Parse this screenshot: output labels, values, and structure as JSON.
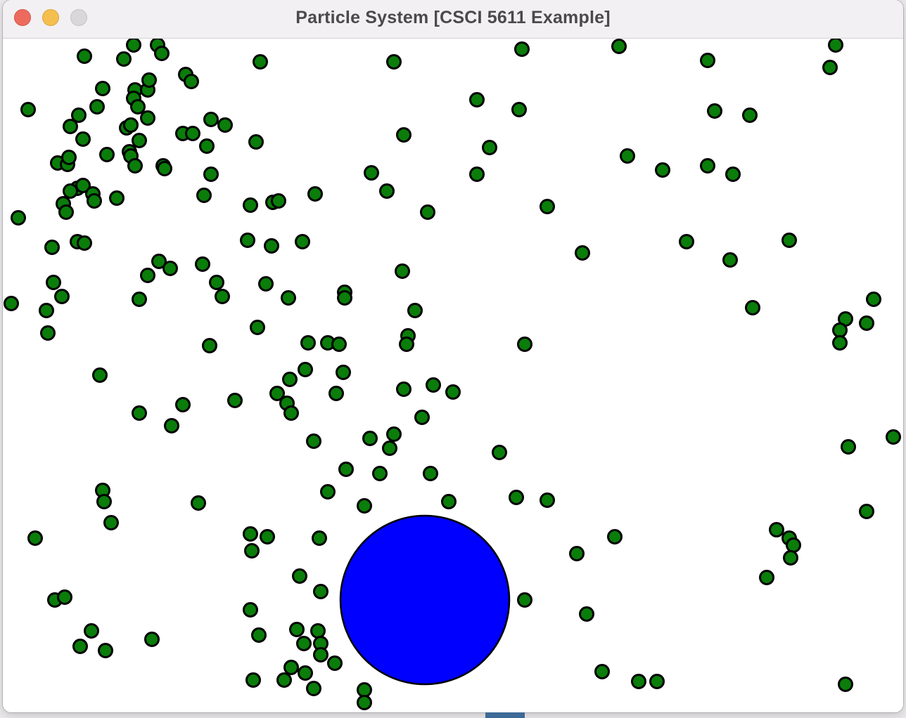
{
  "window": {
    "title": "Particle System [CSCI 5611 Example]",
    "buttons": {
      "close": "close-button",
      "minimize": "minimize-button",
      "zoom": "zoom-button"
    }
  },
  "colors": {
    "particle_fill": "#0a7d0a",
    "particle_stroke": "#000000",
    "obstacle_fill": "#0000ff",
    "obstacle_stroke": "#000000",
    "background": "#ffffff"
  },
  "scene": {
    "particle_count": 214,
    "obstacle_count": 1
  }
}
